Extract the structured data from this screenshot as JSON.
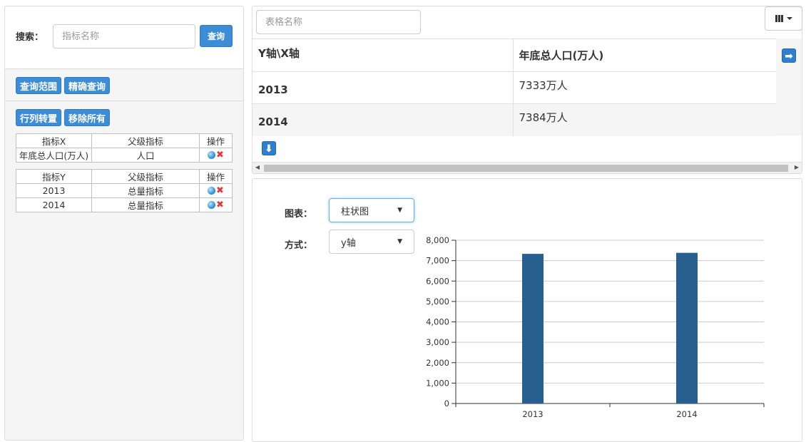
{
  "left": {
    "search_label": "搜索：",
    "search_placeholder": "指标名称",
    "search_button": "查询",
    "range_query_button": "查询范围",
    "exact_query_button": "精确查询",
    "transpose_button": "行列转置",
    "remove_all_button": "移除所有",
    "x_table": {
      "headers": [
        "指标X",
        "父级指标",
        "操作"
      ],
      "rows": [
        {
          "name": "年底总人口(万人)",
          "parent": "人口"
        }
      ]
    },
    "y_table": {
      "headers": [
        "指标Y",
        "父级指标",
        "操作"
      ],
      "rows": [
        {
          "name": "2013",
          "parent": "总量指标"
        },
        {
          "name": "2014",
          "parent": "总量指标"
        }
      ]
    }
  },
  "data_table": {
    "name_placeholder": "表格名称",
    "corner_header": "Y轴\\X轴",
    "column_header": "年底总人口(万人)",
    "rows": [
      {
        "year": "2013",
        "value": "7333万人"
      },
      {
        "year": "2014",
        "value": "7384万人"
      }
    ]
  },
  "chart_form": {
    "type_label": "图表：",
    "type_value": "柱状图",
    "mode_label": "方式：",
    "mode_value": "y轴"
  },
  "colors": {
    "button_blue": "#3c8dd6",
    "bar": "#27608f"
  },
  "icons": [
    "edit-icon",
    "delete-icon",
    "columns-icon",
    "arrow-right-icon",
    "arrow-down-icon"
  ],
  "chart_data": {
    "type": "bar",
    "categories": [
      "2013",
      "2014"
    ],
    "values": [
      7333,
      7384
    ],
    "ylim": [
      0,
      8000
    ],
    "yticks": [
      0,
      1000,
      2000,
      3000,
      4000,
      5000,
      6000,
      7000,
      8000
    ],
    "ytick_labels": [
      "0",
      "1,000",
      "2,000",
      "3,000",
      "4,000",
      "5,000",
      "6,000",
      "7,000",
      "8,000"
    ],
    "grid": true,
    "legend": "none"
  }
}
